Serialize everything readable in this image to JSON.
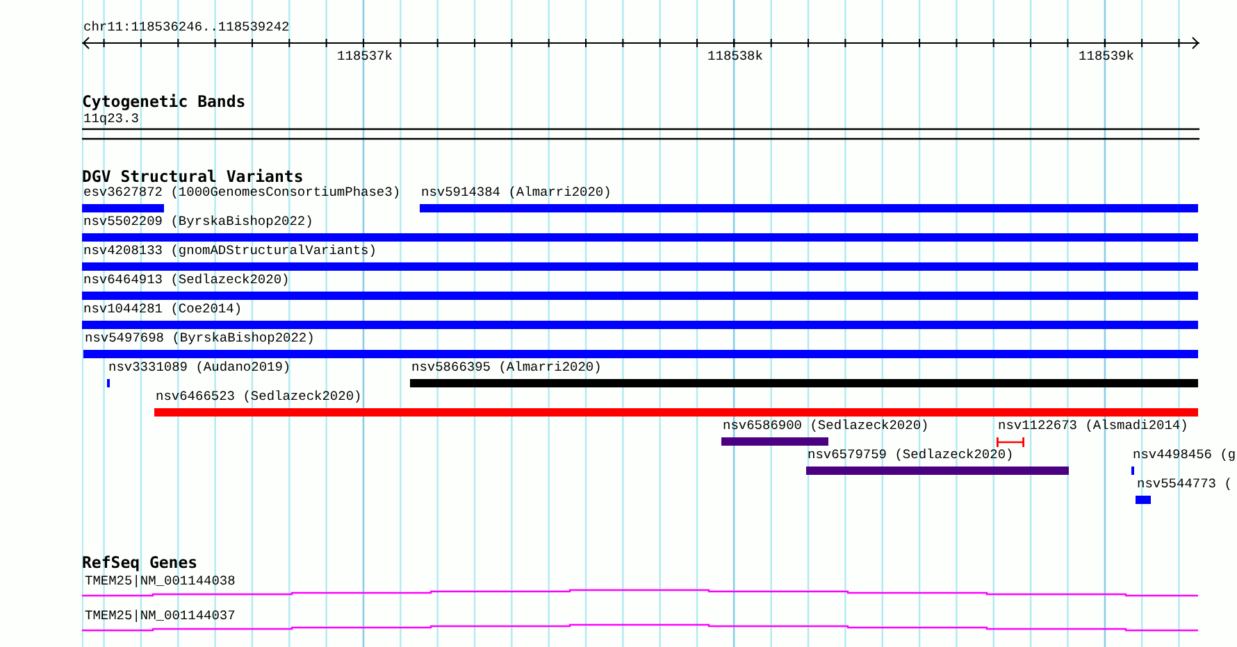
{
  "ruler": {
    "location": "chr11:118536246..118539242",
    "ticks": [
      "118537k",
      "118538k",
      "118539k"
    ]
  },
  "tracks": [
    {
      "kind": "bands",
      "title": "Cytogenetic Bands",
      "features": [
        {
          "label": "11q23.3"
        }
      ]
    },
    {
      "kind": "variants",
      "title": "DGV Structural Variants",
      "features": [
        {
          "kind": "bar",
          "label": "esv3627872 (1000GenomesConsortiumPhase3)",
          "color": "#0000ff"
        },
        {
          "kind": "bar",
          "label": "nsv5914384 (Almarri2020)",
          "color": "#0000ff"
        },
        {
          "kind": "bar",
          "label": "nsv5502209 (ByrskaBishop2022)",
          "color": "#0000ff"
        },
        {
          "kind": "bar",
          "label": "nsv4208133 (gnomADStructuralVariants)",
          "color": "#0000ff"
        },
        {
          "kind": "bar",
          "label": "nsv6464913 (Sedlazeck2020)",
          "color": "#0000ff"
        },
        {
          "kind": "bar",
          "label": "nsv1044281 (Coe2014)",
          "color": "#0000ff"
        },
        {
          "kind": "bar",
          "label": "nsv5497698 (ByrskaBishop2022)",
          "color": "#0000ff"
        },
        {
          "kind": "bar",
          "label": "nsv3331089 (Audano2019)",
          "color": "#0000ff"
        },
        {
          "kind": "bar",
          "label": "nsv5866395 (Almarri2020)",
          "color": "#000000"
        },
        {
          "kind": "bar",
          "label": "nsv6466523 (Sedlazeck2020)",
          "color": "#ff0000"
        },
        {
          "kind": "bar",
          "label": "nsv6586900 (Sedlazeck2020)",
          "color": "#4b0082"
        },
        {
          "kind": "span",
          "label": "nsv1122673 (Alsmadi2014)",
          "color": "#ff0000"
        },
        {
          "kind": "bar",
          "label": "nsv6579759 (Sedlazeck2020)",
          "color": "#4b0082"
        },
        {
          "kind": "bar",
          "label": "nsv4498456 (g",
          "color": "#0000ff"
        },
        {
          "kind": "bar",
          "label": "nsv5544773 (",
          "color": "#0000ff"
        }
      ]
    },
    {
      "kind": "genes",
      "title": "RefSeq Genes",
      "features": [
        {
          "label": "TMEM25|NM_001144038",
          "color": "#ff00ff"
        },
        {
          "label": "TMEM25|NM_001144037",
          "color": "#ff00ff"
        }
      ]
    }
  ]
}
